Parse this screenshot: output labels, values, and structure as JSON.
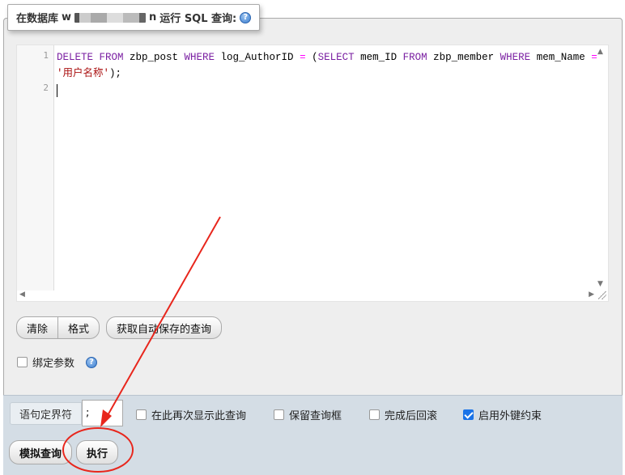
{
  "legend": {
    "prefix": "在数据库",
    "db_visible_start": "w",
    "db_visible_end": "n",
    "suffix": "运行 SQL 查询:",
    "help_glyph": "?"
  },
  "editor": {
    "line_numbers": [
      "1",
      "2"
    ],
    "tokens": {
      "t1": "DELETE FROM",
      "t2": " zbp_post ",
      "t3": "WHERE",
      "t4": " log_AuthorID ",
      "t5": "=",
      "t6": " (",
      "t7": "SELECT",
      "t8": " mem_ID ",
      "t9": "FROM",
      "t10": " zbp_member ",
      "t11": "WHERE",
      "t12": " mem_Name ",
      "t13": "=",
      "t14": "'用户名称'",
      "t15": ");"
    },
    "scroll_up": "▲",
    "scroll_down": "▼",
    "scroll_left": "◀",
    "scroll_right": "▶"
  },
  "buttons": {
    "clear": "清除",
    "format": "格式",
    "get_autosaved": "获取自动保存的查询",
    "simulate": "模拟查询",
    "execute": "执行"
  },
  "bind_params": {
    "label": "绑定参数",
    "help_glyph": "?",
    "checked": false
  },
  "footer": {
    "delimiter_label": "语句定界符",
    "delimiter_value": ";",
    "options": [
      {
        "label": "在此再次显示此查询",
        "checked": false
      },
      {
        "label": "保留查询框",
        "checked": false
      },
      {
        "label": "完成后回滚",
        "checked": false
      },
      {
        "label": "启用外键约束",
        "checked": true
      }
    ]
  },
  "colors": {
    "keyword": "#7a1fa2",
    "operator": "#ff00ff",
    "string": "#aa1111",
    "annotation": "#e8261c",
    "checkbox_checked": "#1a73e8"
  },
  "icons": [
    "help-icon",
    "checkbox-icon",
    "scroll-arrow-icon",
    "resize-grip-icon"
  ]
}
